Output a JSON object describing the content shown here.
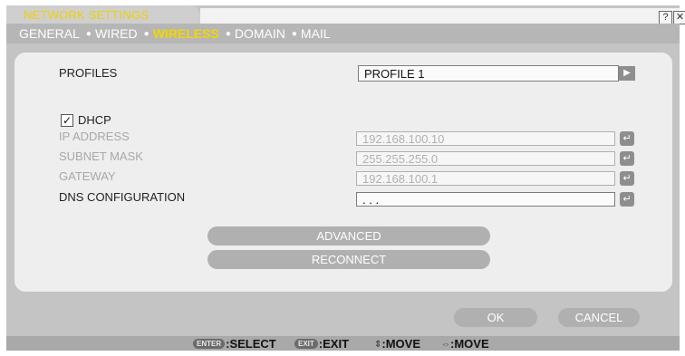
{
  "window": {
    "title": "NETWORK SETTINGS",
    "help_label": "?",
    "close_label": "✕"
  },
  "tabs": [
    {
      "label": "GENERAL",
      "active": false
    },
    {
      "label": "WIRED",
      "active": false
    },
    {
      "label": "WIRELESS",
      "active": true
    },
    {
      "label": "DOMAIN",
      "active": false
    },
    {
      "label": "MAIL",
      "active": false
    }
  ],
  "form": {
    "profiles_label": "PROFILES",
    "profile_value": "PROFILE 1",
    "dhcp_label": "DHCP",
    "dhcp_checked": true,
    "ip_label": "IP ADDRESS",
    "ip_value": "192.168.100.10",
    "subnet_label": "SUBNET MASK",
    "subnet_value": "255.255.255.0",
    "gateway_label": "GATEWAY",
    "gateway_value": "192.168.100.1",
    "dns_label": "DNS CONFIGURATION",
    "dns_value": ". . ."
  },
  "buttons": {
    "advanced": "ADVANCED",
    "reconnect": "RECONNECT",
    "ok": "OK",
    "cancel": "CANCEL"
  },
  "footer": {
    "enter_key": "ENTER",
    "select_label": ":SELECT",
    "exit_key": "EXIT",
    "exit_label": ":EXIT",
    "move_vertical_label": ":MOVE",
    "move_horizontal_label": ":MOVE"
  },
  "colors": {
    "title_text": "#f0d000",
    "active_tab": "#f2d600",
    "window_bg": "#c4c4c4",
    "panel_bg": "#eeeeee"
  },
  "icons": {
    "enter": "enter-icon",
    "arrow_right": "play-arrow-icon",
    "check": "checkmark-icon"
  }
}
